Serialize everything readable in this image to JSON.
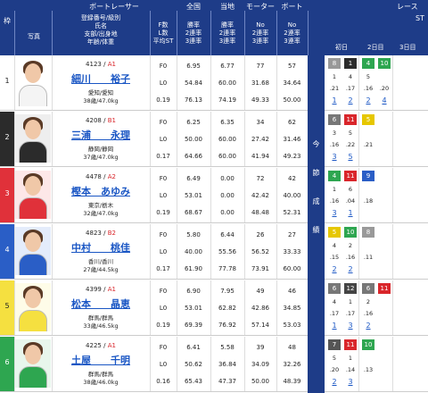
{
  "header": {
    "waku": "枠",
    "photo": "写真",
    "boat_racer": "ボートレーサー",
    "racer_sub": [
      "登録番号/級別",
      "氏名",
      "支部/出身地",
      "年齢/体重"
    ],
    "fst_sub": [
      "F数",
      "L数",
      "平均ST"
    ],
    "national": "全国",
    "local": "当地",
    "motor": "モーター",
    "boat": "ボート",
    "rate_sub": [
      "勝率",
      "2連率",
      "3連率"
    ],
    "num_sub": [
      "No",
      "2連率",
      "3連率"
    ],
    "race": "レース",
    "st": "ST",
    "day1": "初日",
    "day2": "2日目",
    "day3": "3日目",
    "side": [
      "今",
      "節",
      "成",
      "績"
    ]
  },
  "colors": {
    "header_bg": "#1e3c88",
    "waku_bg": [
      "#ffffff",
      "#2b2b2b",
      "#e0313a",
      "#2a5ec6",
      "#f5e040",
      "#2ea650"
    ],
    "waku_fg": [
      "#222222",
      "#ffffff",
      "#ffffff",
      "#ffffff",
      "#222222",
      "#ffffff"
    ],
    "row_accent": [
      "#ffffff",
      "#eeeeee",
      "#fde7e8",
      "#e4ecfb",
      "#fefce8",
      "#e8f6ec"
    ]
  },
  "racers": [
    {
      "waku": "1",
      "reg": "4123",
      "class": "A1",
      "name": "細川　　裕子",
      "origin": "愛知/愛知",
      "age_weight": "38歳/47.0kg",
      "fls": [
        "F0",
        "L0",
        "0.19"
      ],
      "national": [
        "6.95",
        "54.84",
        "76.13"
      ],
      "local": [
        "6.77",
        "60.00",
        "74.19"
      ],
      "motor": [
        "77",
        "31.68",
        "49.33"
      ],
      "boat": [
        "57",
        "34.64",
        "50.00"
      ],
      "results": [
        [
          "8",
          "1",
          "4",
          "10"
        ],
        [
          "1",
          "4",
          "5",
          ""
        ],
        [
          ".21",
          ".17",
          ".16",
          ".20"
        ],
        [
          "1",
          "2",
          "2",
          "4"
        ]
      ]
    },
    {
      "waku": "2",
      "reg": "4208",
      "class": "B1",
      "name": "三浦　　永理",
      "origin": "静岡/静岡",
      "age_weight": "37歳/47.0kg",
      "fls": [
        "F0",
        "L0",
        "0.17"
      ],
      "national": [
        "6.25",
        "50.00",
        "64.66"
      ],
      "local": [
        "6.35",
        "60.00",
        "60.00"
      ],
      "motor": [
        "34",
        "27.42",
        "41.94"
      ],
      "boat": [
        "62",
        "31.46",
        "49.23"
      ],
      "results": [
        [
          "6",
          "11",
          "5",
          ""
        ],
        [
          "3",
          "5",
          "",
          ""
        ],
        [
          ".16",
          ".22",
          ".21",
          ""
        ],
        [
          "3",
          "5",
          "",
          ""
        ]
      ]
    },
    {
      "waku": "3",
      "reg": "4478",
      "class": "A2",
      "name": "樫本　あゆみ",
      "origin": "東京/栃木",
      "age_weight": "32歳/47.0kg",
      "fls": [
        "F0",
        "L0",
        "0.19"
      ],
      "national": [
        "6.49",
        "53.01",
        "68.67"
      ],
      "local": [
        "0.00",
        "0.00",
        "0.00"
      ],
      "motor": [
        "72",
        "42.42",
        "48.48"
      ],
      "boat": [
        "42",
        "40.00",
        "52.31"
      ],
      "results": [
        [
          "4",
          "11",
          "9",
          ""
        ],
        [
          "1",
          "6",
          "",
          ""
        ],
        [
          ".16",
          ".04",
          ".18",
          ""
        ],
        [
          "3",
          "1",
          "",
          ""
        ]
      ]
    },
    {
      "waku": "4",
      "reg": "4823",
      "class": "B2",
      "name": "中村　　桃佳",
      "origin": "香川/香川",
      "age_weight": "27歳/44.5kg",
      "fls": [
        "F0",
        "L0",
        "0.17"
      ],
      "national": [
        "5.80",
        "40.00",
        "61.90"
      ],
      "local": [
        "6.44",
        "55.56",
        "77.78"
      ],
      "motor": [
        "26",
        "56.52",
        "73.91"
      ],
      "boat": [
        "27",
        "33.33",
        "60.00"
      ],
      "results": [
        [
          "5",
          "10",
          "8",
          ""
        ],
        [
          "4",
          "2",
          "",
          ""
        ],
        [
          ".15",
          ".16",
          ".11",
          ""
        ],
        [
          "2",
          "2",
          "",
          ""
        ]
      ]
    },
    {
      "waku": "5",
      "reg": "4399",
      "class": "A1",
      "name": "松本　　晶恵",
      "origin": "群馬/群馬",
      "age_weight": "33歳/46.5kg",
      "fls": [
        "F0",
        "L0",
        "0.19"
      ],
      "national": [
        "6.90",
        "53.01",
        "69.39"
      ],
      "local": [
        "7.95",
        "62.82",
        "76.92"
      ],
      "motor": [
        "49",
        "42.86",
        "57.14"
      ],
      "boat": [
        "46",
        "34.85",
        "53.03"
      ],
      "results": [
        [
          "6",
          "12",
          "6",
          "11"
        ],
        [
          "4",
          "1",
          "2",
          ""
        ],
        [
          ".17",
          ".17",
          ".16",
          ""
        ],
        [
          "1",
          "3",
          "2",
          ""
        ]
      ]
    },
    {
      "waku": "6",
      "reg": "4225",
      "class": "A1",
      "name": "土屋　　千明",
      "origin": "群馬/群馬",
      "age_weight": "38歳/46.0kg",
      "fls": [
        "F0",
        "L0",
        "0.16"
      ],
      "national": [
        "6.41",
        "50.62",
        "65.43"
      ],
      "local": [
        "5.58",
        "36.84",
        "47.37"
      ],
      "motor": [
        "39",
        "34.09",
        "50.00"
      ],
      "boat": [
        "48",
        "32.26",
        "48.39"
      ],
      "results": [
        [
          "7",
          "11",
          "10",
          ""
        ],
        [
          "5",
          "1",
          "",
          ""
        ],
        [
          ".20",
          ".14",
          ".13",
          ""
        ],
        [
          "2",
          "3",
          "",
          ""
        ]
      ]
    }
  ]
}
